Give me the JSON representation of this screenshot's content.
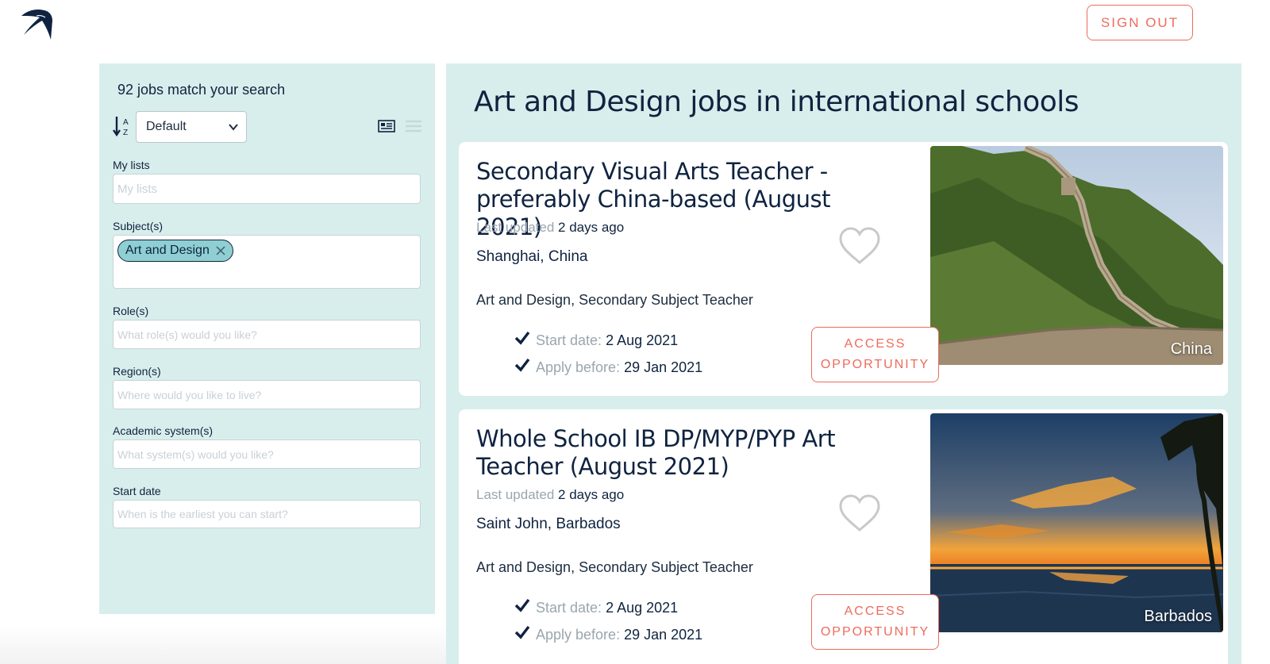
{
  "header": {
    "logo_icon": "swallow-logo-icon",
    "sign_out_label": "SIGN OUT"
  },
  "sidebar": {
    "match_text": "92 jobs match your search",
    "sort": {
      "icon": "sort-az-icon",
      "selected": "Default"
    },
    "view_icons": [
      "grid-view-icon",
      "list-view-icon"
    ],
    "filters": {
      "my_lists": {
        "label": "My lists",
        "placeholder": "My lists"
      },
      "subjects": {
        "label": "Subject(s)",
        "tags": [
          "Art and Design"
        ]
      },
      "roles": {
        "label": "Role(s)",
        "placeholder": "What role(s) would you like?"
      },
      "regions": {
        "label": "Region(s)",
        "placeholder": "Where would you like to live?"
      },
      "academic": {
        "label": "Academic system(s)",
        "placeholder": "What system(s) would you like?"
      },
      "start": {
        "label": "Start date",
        "placeholder": "When is the earliest you can start?"
      }
    }
  },
  "main": {
    "title": "Art and Design jobs in international schools",
    "jobs": [
      {
        "title": "Secondary Visual Arts Teacher - preferably China-based (August 2021)",
        "updated_label": "Last updated",
        "updated_value": "2 days ago",
        "location": "Shanghai, China",
        "subjects": "Art and Design, Secondary Subject Teacher",
        "start_label": "Start date:",
        "start_value": "2 Aug 2021",
        "apply_label": "Apply before:",
        "apply_value": "29 Jan 2021",
        "access_line1": "ACCESS",
        "access_line2": "OPPORTUNITY",
        "country": "China"
      },
      {
        "title": "Whole School IB DP/MYP/PYP Art Teacher (August 2021)",
        "updated_label": "Last updated",
        "updated_value": "2 days ago",
        "location": "Saint John, Barbados",
        "subjects": "Art and Design, Secondary Subject Teacher",
        "start_label": "Start date:",
        "start_value": "2 Aug 2021",
        "apply_label": "Apply before:",
        "apply_value": "29 Jan 2021",
        "access_line1": "ACCESS",
        "access_line2": "OPPORTUNITY",
        "country": "Barbados"
      }
    ]
  },
  "colors": {
    "navy": "#0f2340",
    "panel": "#d8eeec",
    "accent": "#ee6b5b",
    "tag": "#8fcfd2"
  }
}
